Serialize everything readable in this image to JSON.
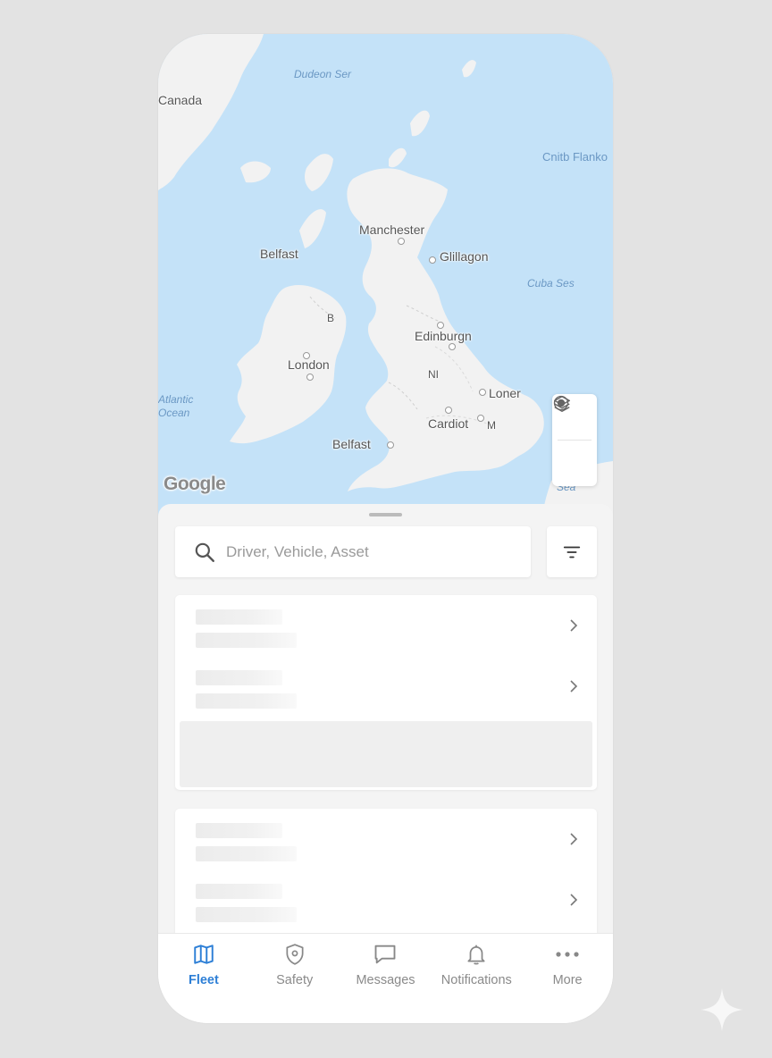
{
  "map": {
    "attribution": "Google",
    "labels": {
      "canada": "Canada",
      "dudeon_ser": "Dudeon Ser",
      "cnitb_flanko": "Cnitb Flanko",
      "belfast_west": "Belfast",
      "manchester": "Manchester",
      "glillagon": "Glillagon",
      "cuba_ses": "Cuba Ses",
      "b": "B",
      "edinburgh": "Edinburgn",
      "london": "London",
      "ni": "NI",
      "loner": "Loner",
      "cardiff": "Cardiot",
      "m": "M",
      "belfast_south": "Belfast",
      "atlantic_1": "Atlantic",
      "atlantic_2": "Ocean",
      "sea_se": "Sea"
    },
    "controls": {
      "layers_icon": "layers-icon",
      "locate_icon": "my-location-icon"
    }
  },
  "search": {
    "placeholder": "Driver, Vehicle, Asset",
    "value": ""
  },
  "filter": {
    "icon": "filter-icon"
  },
  "nav": {
    "items": [
      {
        "label": "Fleet",
        "icon": "map-icon",
        "active": true
      },
      {
        "label": "Safety",
        "icon": "shield-icon",
        "active": false
      },
      {
        "label": "Messages",
        "icon": "message-icon",
        "active": false
      },
      {
        "label": "Notifications",
        "icon": "bell-icon",
        "active": false
      },
      {
        "label": "More",
        "icon": "more-icon",
        "active": false
      }
    ]
  },
  "colors": {
    "accent": "#2d7fd6",
    "water": "#c4e2f8",
    "land": "#f2f2f2",
    "inactive": "#8a8a8a"
  }
}
